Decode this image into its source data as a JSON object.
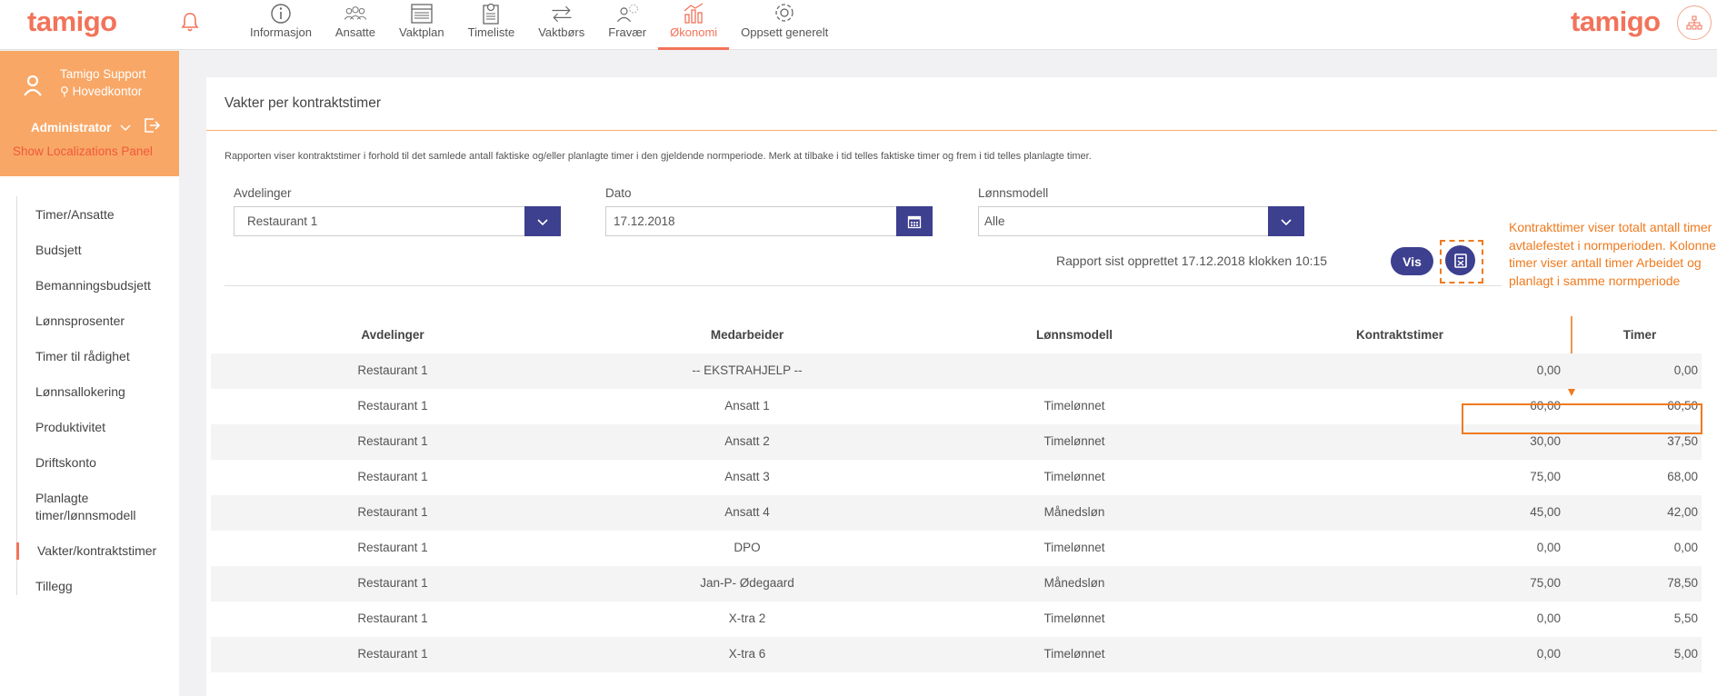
{
  "brand": {
    "logo": "tamigo",
    "accent": "#f2735a"
  },
  "nav": {
    "items": [
      {
        "label": "Informasjon",
        "icon": "info-icon"
      },
      {
        "label": "Ansatte",
        "icon": "people-icon"
      },
      {
        "label": "Vaktplan",
        "icon": "calendar-grid-icon"
      },
      {
        "label": "Timeliste",
        "icon": "timesheet-icon"
      },
      {
        "label": "Vaktbørs",
        "icon": "swap-arrows-icon"
      },
      {
        "label": "Fravær",
        "icon": "absence-icon"
      },
      {
        "label": "Økonomi",
        "icon": "economy-chart-icon"
      },
      {
        "label": "Oppsett generelt",
        "icon": "gear-icon"
      }
    ],
    "active": "Økonomi"
  },
  "user": {
    "name": "Tamigo Support",
    "location": "Hovedkontor",
    "role": "Administrator",
    "localization_link": "Show Localizations Panel"
  },
  "sidebar": {
    "items": [
      {
        "label": "Timer/Ansatte"
      },
      {
        "label": "Budsjett"
      },
      {
        "label": "Bemanningsbudsjett"
      },
      {
        "label": "Lønnsprosenter"
      },
      {
        "label": "Timer til rådighet"
      },
      {
        "label": "Lønnsallokering"
      },
      {
        "label": "Produktivitet"
      },
      {
        "label": "Driftskonto"
      },
      {
        "label": "Planlagte timer/lønnsmodell"
      },
      {
        "label": "Vakter/kontraktstimer"
      },
      {
        "label": "Tillegg"
      }
    ],
    "active_index": 9
  },
  "page": {
    "title": "Vakter per kontraktstimer",
    "description": "Rapporten viser kontraktstimer i forhold til det samlede antall faktiske og/eller planlagte timer i den gjeldende normperiode. Merk at tilbake i tid telles faktiske timer og frem i tid telles planlagte timer."
  },
  "filters": {
    "department": {
      "label": "Avdelinger",
      "value": "Restaurant 1"
    },
    "date": {
      "label": "Dato",
      "value": "17.12.2018"
    },
    "pay_model": {
      "label": "Lønnsmodell",
      "value": "Alle"
    }
  },
  "report": {
    "created": "Rapport sist opprettet 17.12.2018 klokken 10:15",
    "vis_label": "Vis"
  },
  "annotation": {
    "text": "Kontrakttimer viser totalt antall timer avtalefestet i normperioden. Kolonne timer viser antall timer Arbeidet og planlagt i samme normperiode",
    "color": "#f07a1e"
  },
  "table": {
    "headers": {
      "avdelinger": "Avdelinger",
      "medarbeider": "Medarbeider",
      "lonnsmodell": "Lønnsmodell",
      "kontraktstimer": "Kontraktstimer",
      "timer": "Timer"
    },
    "rows": [
      [
        "Restaurant 1",
        "-- EKSTRAHJELP --",
        "",
        "0,00",
        "0,00"
      ],
      [
        "Restaurant 1",
        "Ansatt 1",
        "Timelønnet",
        "60,00",
        "60,50"
      ],
      [
        "Restaurant 1",
        "Ansatt 2",
        "Timelønnet",
        "30,00",
        "37,50"
      ],
      [
        "Restaurant 1",
        "Ansatt 3",
        "Timelønnet",
        "75,00",
        "68,00"
      ],
      [
        "Restaurant 1",
        "Ansatt 4",
        "Månedsløn",
        "45,00",
        "42,00"
      ],
      [
        "Restaurant 1",
        "DPO",
        "Timelønnet",
        "0,00",
        "0,00"
      ],
      [
        "Restaurant 1",
        "Jan-P- Ødegaard",
        "Månedsløn",
        "75,00",
        "78,50"
      ],
      [
        "Restaurant 1",
        "X-tra 2",
        "Timelønnet",
        "0,00",
        "5,50"
      ],
      [
        "Restaurant 1",
        "X-tra 6",
        "Timelønnet",
        "0,00",
        "5,00"
      ]
    ]
  }
}
